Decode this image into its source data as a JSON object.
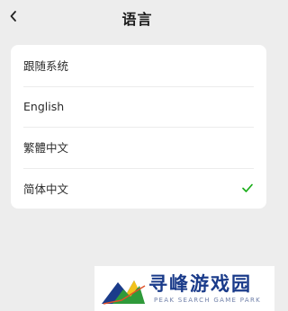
{
  "header": {
    "title": "语言",
    "back_icon": "chevron-left-icon"
  },
  "language_list": {
    "options": [
      {
        "label": "跟随系统",
        "selected": false
      },
      {
        "label": "English",
        "selected": false
      },
      {
        "label": "繁體中文",
        "selected": false
      },
      {
        "label": "简体中文",
        "selected": true
      }
    ],
    "selected_icon": "check-icon"
  },
  "watermark": {
    "title": "寻峰游戏园",
    "subtitle": "PEAK SEARCH GAME PARK"
  },
  "colors": {
    "background": "#ededed",
    "card": "#ffffff",
    "check": "#1aad19",
    "watermark_title": "#1a3b8a"
  }
}
